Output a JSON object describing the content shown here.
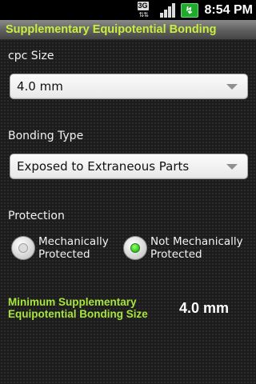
{
  "status_bar": {
    "network_label": "3G",
    "clock": "8:54 PM",
    "battery_glyph": "↯",
    "icons": [
      "network-3g-icon",
      "signal-bars-icon",
      "battery-charging-icon"
    ]
  },
  "app": {
    "title": "Supplementary Equipotential Bonding"
  },
  "cpc_size": {
    "label": "cpc Size",
    "selected": "4.0 mm"
  },
  "bonding_type": {
    "label": "Bonding Type",
    "selected": "Exposed to Extraneous Parts"
  },
  "protection": {
    "label": "Protection",
    "options": [
      {
        "label_line1": "Mechanically",
        "label_line2": "Protected",
        "checked": false
      },
      {
        "label_line1": "Not Mechanically",
        "label_line2": "Protected",
        "checked": true
      }
    ]
  },
  "result": {
    "label_line1": "Minimum Supplementary",
    "label_line2": "Equipotential Bonding Size",
    "value": "4.0 mm"
  },
  "colors": {
    "accent_green": "#c8f03c",
    "result_label": "#a8e63c",
    "radio_checked": "#2cc51e",
    "battery": "#1faa2c"
  }
}
